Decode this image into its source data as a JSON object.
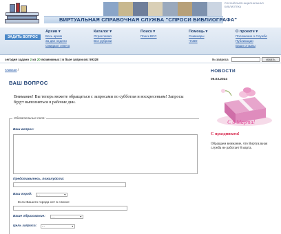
{
  "header": {
    "site_title": "ВИРТУАЛЬНАЯ СПРАВОЧНАЯ СЛУЖБА \"СПРОСИ БИБЛИОГРАФА\"",
    "library_name": "РОССИЙСКАЯ НАЦИОНАЛЬНАЯ БИБЛИОТЕКА",
    "ask_button": "ЗАДАТЬ ВОПРОС"
  },
  "nav": [
    {
      "heading": "Архив ▾",
      "items": [
        "Весь архив",
        "За две недели",
        "Ожидают ответа"
      ]
    },
    {
      "heading": "Каталог ▾",
      "items": [
        "Отраслевая",
        "Все рубрики"
      ]
    },
    {
      "heading": "Поиск ▾",
      "items": [
        "Поиск ВСС"
      ]
    },
    {
      "heading": "Помощь ▾",
      "items": [
        "Семинары",
        "ЧАВО"
      ]
    },
    {
      "heading": "О проекте ▾",
      "items": [
        "Положение о Службе",
        "Публикации",
        "Ваши отзывы"
      ]
    }
  ],
  "counter": {
    "prefix": "сегодня задано ",
    "asked": "2",
    "middle": " из ",
    "possible": "20",
    "suffix": " возможных | в базе запросов: 59328"
  },
  "search": {
    "label": "№ запроса",
    "button": "искать"
  },
  "breadcrumb": {
    "home": "Главная",
    "separator": " /"
  },
  "main": {
    "title": "ВАШ ВОПРОС",
    "notice": "Внимание! Вы теперь можете обращаться с запросами по субботам и воскресеньям! Запросы будут выполняться в рабочие дни.",
    "legend": "Обязательные поля:",
    "labels": {
      "question": "Ваш вопрос:",
      "intro": "Представьтесь, пожалуйста:",
      "city": "Ваш город:",
      "city_hint": "Если Вашего города нет в списке:",
      "education": "Ваше образование:",
      "purpose": "Цель запроса:"
    },
    "select_placeholder": "- -"
  },
  "sidebar": {
    "heading": "НОВОСТИ",
    "date": "05.03.2024",
    "greeting": "С 8 Марта!",
    "holiday": "С праздником!",
    "notice": "Обращаем внимание, что Виртуальная служба не работает 8 марта."
  },
  "colors": {
    "brand": "#1d3f73",
    "link": "#2458a6",
    "ask_button": "#4b88c8",
    "holiday_red": "#d6264b",
    "greeting_pink": "#e14c9a"
  }
}
